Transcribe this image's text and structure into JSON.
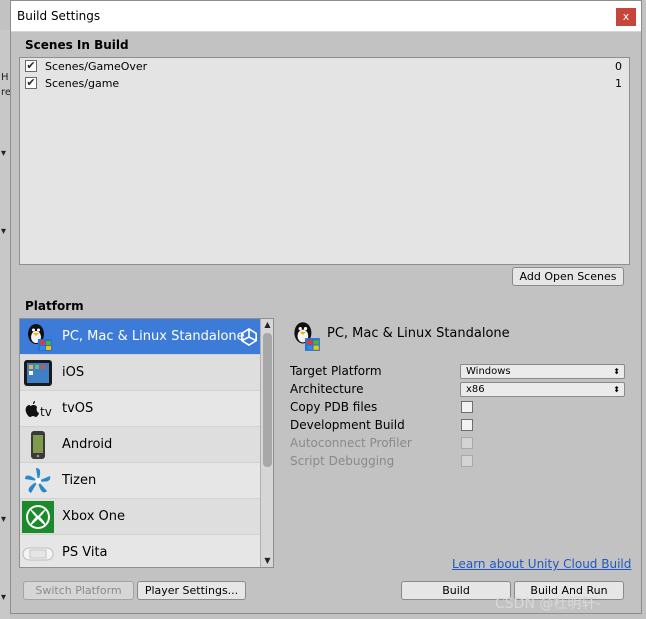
{
  "window": {
    "title": "Build Settings",
    "close_glyph": "x"
  },
  "scenes": {
    "label": "Scenes In Build",
    "items": [
      {
        "name": "Scenes/GameOver",
        "index": "0",
        "checked": true
      },
      {
        "name": "Scenes/game",
        "index": "1",
        "checked": true
      }
    ],
    "add_open_scenes_label": "Add Open Scenes"
  },
  "platform": {
    "label": "Platform",
    "items": [
      {
        "label": "PC, Mac & Linux Standalone",
        "icon": "linux-penguin-icon",
        "selected": true
      },
      {
        "label": "iOS",
        "icon": "ipad-icon"
      },
      {
        "label": "tvOS",
        "icon": "apple-tv-icon"
      },
      {
        "label": "Android",
        "icon": "android-phone-icon"
      },
      {
        "label": "Tizen",
        "icon": "tizen-icon"
      },
      {
        "label": "Xbox One",
        "icon": "xbox-icon"
      },
      {
        "label": "PS Vita",
        "icon": "ps-vita-icon"
      }
    ]
  },
  "details": {
    "title": "PC, Mac & Linux Standalone",
    "target_platform": {
      "label": "Target Platform",
      "value": "Windows"
    },
    "architecture": {
      "label": "Architecture",
      "value": "x86"
    },
    "copy_pdb": {
      "label": "Copy PDB files",
      "checked": false
    },
    "development_build": {
      "label": "Development Build",
      "checked": false
    },
    "autoconnect_profiler": {
      "label": "Autoconnect Profiler",
      "checked": false,
      "disabled": true
    },
    "script_debugging": {
      "label": "Script Debugging",
      "checked": false,
      "disabled": true
    }
  },
  "footer": {
    "cloud_link": "Learn about Unity Cloud Build",
    "switch_platform": "Switch Platform",
    "player_settings": "Player Settings...",
    "build": "Build",
    "build_and_run": "Build And Run"
  },
  "watermark": "CSDN @杜明轩-",
  "colors": {
    "selected": "#3d7bd9",
    "link": "#1f58c2",
    "close": "#c8453c"
  }
}
